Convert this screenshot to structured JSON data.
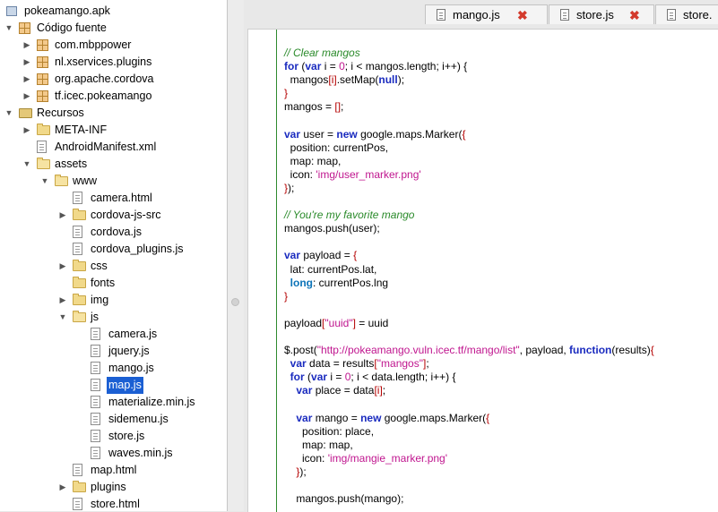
{
  "tree": {
    "items": [
      {
        "label": "pokeamango.apk",
        "depth": 0,
        "arrow": "",
        "icon": "apk"
      },
      {
        "label": "Código fuente",
        "depth": 0,
        "arrow": "down",
        "icon": "package-root"
      },
      {
        "label": "com.mbppower",
        "depth": 1,
        "arrow": "right",
        "icon": "package"
      },
      {
        "label": "nl.xservices.plugins",
        "depth": 1,
        "arrow": "right",
        "icon": "package"
      },
      {
        "label": "org.apache.cordova",
        "depth": 1,
        "arrow": "right",
        "icon": "package"
      },
      {
        "label": "tf.icec.pokeamango",
        "depth": 1,
        "arrow": "right",
        "icon": "package"
      },
      {
        "label": "Recursos",
        "depth": 0,
        "arrow": "down",
        "icon": "resources"
      },
      {
        "label": "META-INF",
        "depth": 1,
        "arrow": "right",
        "icon": "folder"
      },
      {
        "label": "AndroidManifest.xml",
        "depth": 1,
        "arrow": "",
        "icon": "file"
      },
      {
        "label": "assets",
        "depth": 1,
        "arrow": "down",
        "icon": "folder"
      },
      {
        "label": "www",
        "depth": 2,
        "arrow": "down",
        "icon": "folder"
      },
      {
        "label": "camera.html",
        "depth": 3,
        "arrow": "",
        "icon": "file"
      },
      {
        "label": "cordova-js-src",
        "depth": 3,
        "arrow": "right",
        "icon": "folder"
      },
      {
        "label": "cordova.js",
        "depth": 3,
        "arrow": "",
        "icon": "file"
      },
      {
        "label": "cordova_plugins.js",
        "depth": 3,
        "arrow": "",
        "icon": "file"
      },
      {
        "label": "css",
        "depth": 3,
        "arrow": "right",
        "icon": "folder"
      },
      {
        "label": "fonts",
        "depth": 3,
        "arrow": "",
        "icon": "folder"
      },
      {
        "label": "img",
        "depth": 3,
        "arrow": "right",
        "icon": "folder"
      },
      {
        "label": "js",
        "depth": 3,
        "arrow": "down",
        "icon": "folder"
      },
      {
        "label": "camera.js",
        "depth": 4,
        "arrow": "",
        "icon": "file"
      },
      {
        "label": "jquery.js",
        "depth": 4,
        "arrow": "",
        "icon": "file"
      },
      {
        "label": "mango.js",
        "depth": 4,
        "arrow": "",
        "icon": "file"
      },
      {
        "label": "map.js",
        "depth": 4,
        "arrow": "",
        "icon": "file",
        "selected": true
      },
      {
        "label": "materialize.min.js",
        "depth": 4,
        "arrow": "",
        "icon": "file"
      },
      {
        "label": "sidemenu.js",
        "depth": 4,
        "arrow": "",
        "icon": "file"
      },
      {
        "label": "store.js",
        "depth": 4,
        "arrow": "",
        "icon": "file"
      },
      {
        "label": "waves.min.js",
        "depth": 4,
        "arrow": "",
        "icon": "file"
      },
      {
        "label": "map.html",
        "depth": 3,
        "arrow": "",
        "icon": "file"
      },
      {
        "label": "plugins",
        "depth": 3,
        "arrow": "right",
        "icon": "folder"
      },
      {
        "label": "store.html",
        "depth": 3,
        "arrow": "",
        "icon": "file"
      }
    ]
  },
  "tabs": [
    {
      "label": "mango.js",
      "closable": true
    },
    {
      "label": "store.js",
      "closable": true
    },
    {
      "label": "store.",
      "closable": false
    }
  ],
  "close_glyph": "✖",
  "code_lines": [
    [
      [
        "c",
        "// Clear mangos"
      ]
    ],
    [
      [
        "k",
        "for"
      ],
      [
        "t",
        " ("
      ],
      [
        "k",
        "var"
      ],
      [
        "t",
        " i = "
      ],
      [
        "s",
        "0"
      ],
      [
        "t",
        "; i < mangos.length; i++) {"
      ]
    ],
    [
      [
        "t",
        "  mangos"
      ],
      [
        "p",
        "[i]"
      ],
      [
        "t",
        ".setMap("
      ],
      [
        "k",
        "null"
      ],
      [
        "t",
        ");"
      ]
    ],
    [
      [
        "p",
        "}"
      ]
    ],
    [
      [
        "t",
        "mangos = "
      ],
      [
        "p",
        "[]"
      ],
      [
        "t",
        ";"
      ]
    ],
    [
      [
        "t",
        ""
      ]
    ],
    [
      [
        "k",
        "var"
      ],
      [
        "t",
        " user = "
      ],
      [
        "k",
        "new"
      ],
      [
        "t",
        " google.maps.Marker("
      ],
      [
        "p",
        "{"
      ]
    ],
    [
      [
        "t",
        "  position: currentPos,"
      ]
    ],
    [
      [
        "t",
        "  map: map,"
      ]
    ],
    [
      [
        "t",
        "  icon: "
      ],
      [
        "s",
        "'img/user_marker.png'"
      ]
    ],
    [
      [
        "p",
        "}"
      ],
      [
        "t",
        ");"
      ]
    ],
    [
      [
        "t",
        ""
      ]
    ],
    [
      [
        "c",
        "// You're my favorite mango"
      ]
    ],
    [
      [
        "t",
        "mangos.push(user);"
      ]
    ],
    [
      [
        "t",
        ""
      ]
    ],
    [
      [
        "k",
        "var"
      ],
      [
        "t",
        " payload = "
      ],
      [
        "p",
        "{"
      ]
    ],
    [
      [
        "t",
        "  lat: currentPos.lat,"
      ]
    ],
    [
      [
        "t",
        "  "
      ],
      [
        "kw2",
        "long"
      ],
      [
        "t",
        ": currentPos.lng"
      ]
    ],
    [
      [
        "p",
        "}"
      ]
    ],
    [
      [
        "t",
        ""
      ]
    ],
    [
      [
        "t",
        "payload"
      ],
      [
        "p",
        "["
      ],
      [
        "s",
        "\"uuid\""
      ],
      [
        "p",
        "]"
      ],
      [
        "t",
        " = uuid"
      ]
    ],
    [
      [
        "t",
        ""
      ]
    ],
    [
      [
        "t",
        "$.post("
      ],
      [
        "s",
        "\"http://pokeamango.vuln.icec.tf/mango/list\""
      ],
      [
        "t",
        ", payload, "
      ],
      [
        "k",
        "function"
      ],
      [
        "t",
        "(results)"
      ],
      [
        "p",
        "{"
      ]
    ],
    [
      [
        "t",
        "  "
      ],
      [
        "k",
        "var"
      ],
      [
        "t",
        " data = results"
      ],
      [
        "p",
        "["
      ],
      [
        "s",
        "\"mangos\""
      ],
      [
        "p",
        "]"
      ],
      [
        "t",
        ";"
      ]
    ],
    [
      [
        "t",
        "  "
      ],
      [
        "k",
        "for"
      ],
      [
        "t",
        " ("
      ],
      [
        "k",
        "var"
      ],
      [
        "t",
        " i = "
      ],
      [
        "s",
        "0"
      ],
      [
        "t",
        "; i < data.length; i++) {"
      ]
    ],
    [
      [
        "t",
        "    "
      ],
      [
        "k",
        "var"
      ],
      [
        "t",
        " place = data"
      ],
      [
        "p",
        "[i]"
      ],
      [
        "t",
        ";"
      ]
    ],
    [
      [
        "t",
        ""
      ]
    ],
    [
      [
        "t",
        "    "
      ],
      [
        "k",
        "var"
      ],
      [
        "t",
        " mango = "
      ],
      [
        "k",
        "new"
      ],
      [
        "t",
        " google.maps.Marker("
      ],
      [
        "p",
        "{"
      ]
    ],
    [
      [
        "t",
        "      position: place,"
      ]
    ],
    [
      [
        "t",
        "      map: map,"
      ]
    ],
    [
      [
        "t",
        "      icon: "
      ],
      [
        "s",
        "'img/mangie_marker.png'"
      ]
    ],
    [
      [
        "t",
        "    "
      ],
      [
        "p",
        "}"
      ],
      [
        "t",
        ");"
      ]
    ],
    [
      [
        "t",
        ""
      ]
    ],
    [
      [
        "t",
        "    mangos.push(mango);"
      ]
    ]
  ]
}
